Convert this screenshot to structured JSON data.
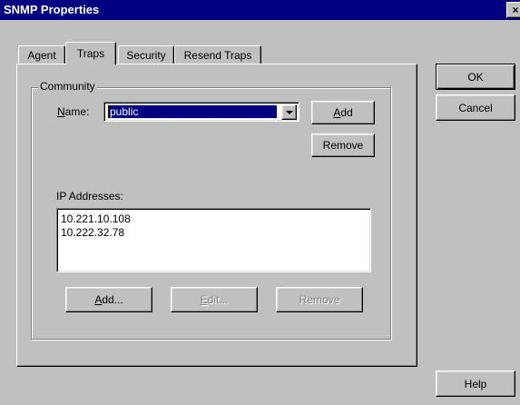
{
  "window": {
    "title": "SNMP Properties",
    "close_glyph": "×"
  },
  "tabs": [
    {
      "label": "Agent"
    },
    {
      "label": "Traps"
    },
    {
      "label": "Security"
    },
    {
      "label": "Resend Traps"
    }
  ],
  "active_tab": "Traps",
  "community": {
    "group_label": "Community",
    "name_label": "Name:",
    "selected": "public",
    "add_label": "Add",
    "remove_label": "Remove"
  },
  "ip": {
    "label": "IP Addresses:",
    "items": [
      "10.221.10.108",
      "10.222.32.78"
    ],
    "add_label": "Add...",
    "edit_label": "Edit...",
    "remove_label": "Remove"
  },
  "dialog_buttons": {
    "ok": "OK",
    "cancel": "Cancel",
    "help": "Help"
  }
}
